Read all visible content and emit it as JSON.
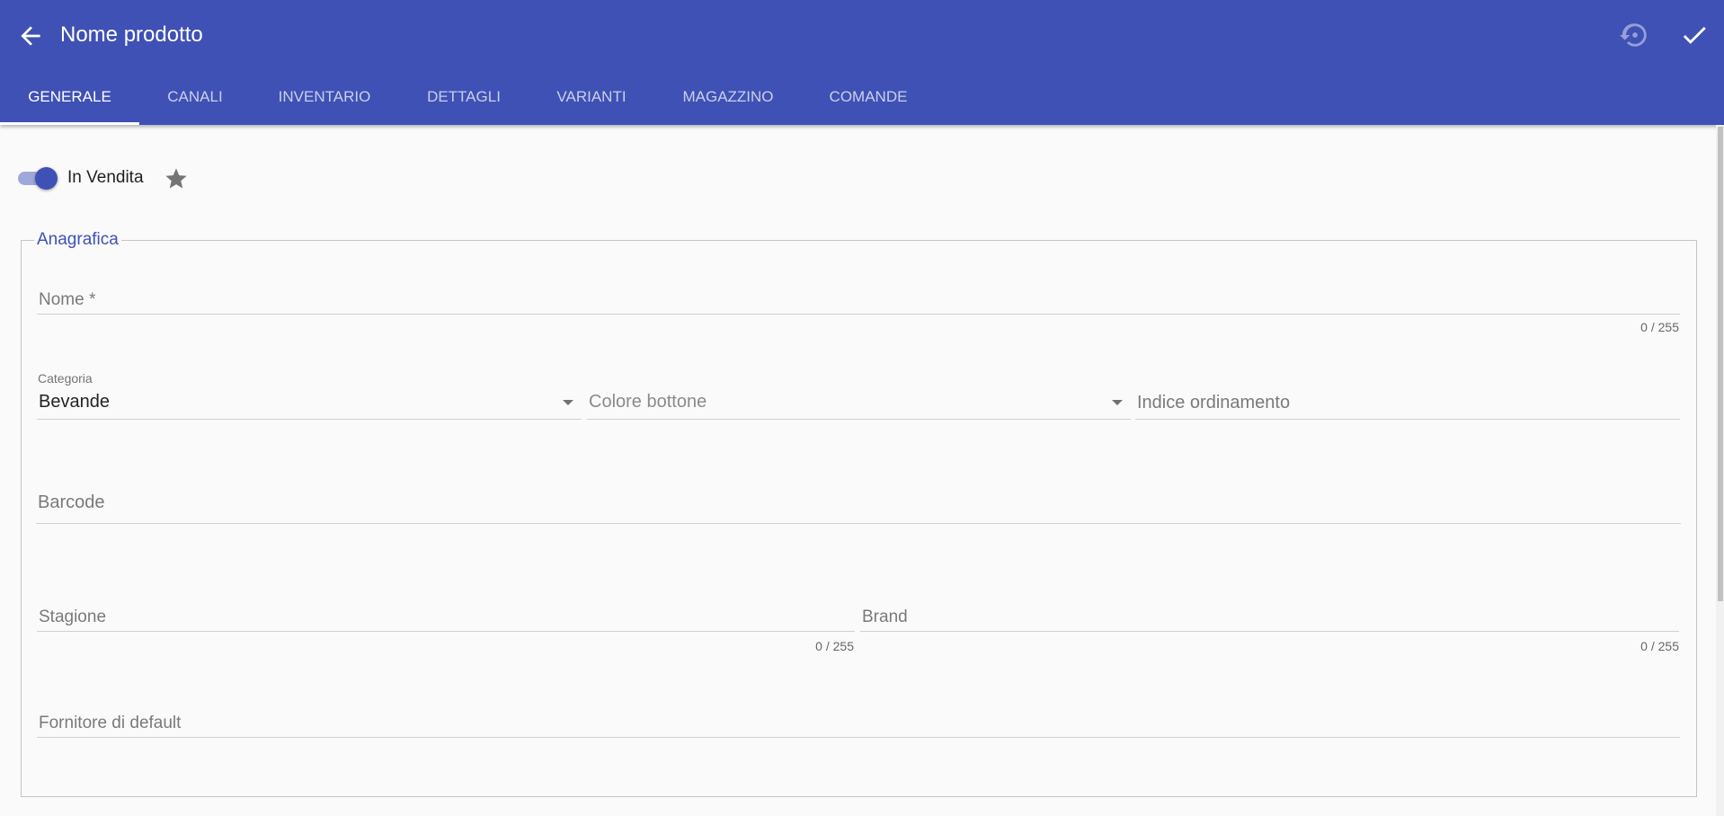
{
  "header": {
    "title": "Nome prodotto",
    "back_icon": "arrow-left",
    "reset_icon": "history-restore",
    "confirm_icon": "check"
  },
  "tabs": [
    {
      "label": "GENERALE",
      "active": true
    },
    {
      "label": "CANALI",
      "active": false
    },
    {
      "label": "INVENTARIO",
      "active": false
    },
    {
      "label": "DETTAGLI",
      "active": false
    },
    {
      "label": "VARIANTI",
      "active": false
    },
    {
      "label": "MAGAZZINO",
      "active": false
    },
    {
      "label": "COMANDE",
      "active": false
    }
  ],
  "sale_toggle": {
    "label": "In Vendita",
    "checked": true
  },
  "favorite_icon": "star",
  "anagrafica": {
    "legend": "Anagrafica",
    "nome": {
      "placeholder": "Nome *",
      "value": "",
      "counter": "0 / 255"
    },
    "categoria": {
      "label": "Categoria",
      "value": "Bevande"
    },
    "colore_bottone": {
      "placeholder": "Colore bottone"
    },
    "indice_ordinamento": {
      "placeholder": "Indice ordinamento",
      "value": ""
    },
    "barcode": {
      "placeholder": "Barcode",
      "value": ""
    },
    "stagione": {
      "placeholder": "Stagione",
      "value": "",
      "counter": "0 / 255"
    },
    "brand": {
      "placeholder": "Brand",
      "value": "",
      "counter": "0 / 255"
    },
    "fornitore": {
      "placeholder": "Fornitore di default",
      "value": ""
    }
  },
  "colors": {
    "primary": "#3f51b5",
    "toggle_track": "#9fa8da",
    "background": "#fafafa"
  }
}
